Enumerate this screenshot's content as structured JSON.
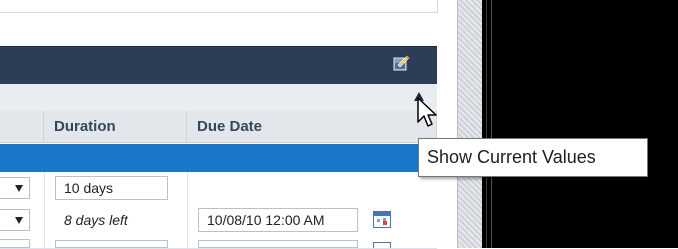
{
  "columns": {
    "duration": "Duration",
    "due_date": "Due Date"
  },
  "rows": [
    {
      "duration": "10 days",
      "due_date": ""
    },
    {
      "duration": "8 days left",
      "due_date": "10/08/10 12:00 AM"
    }
  ],
  "tooltip": "Show Current Values",
  "icons": {
    "header": "notes-edit-icon",
    "calendar": "calendar-icon",
    "sort": "sort-ascending-icon",
    "cursor": "mouse-pointer-icon"
  },
  "colors": {
    "header_bar": "#2c3d55",
    "selected_row": "#1a76c8",
    "tooltip_bg": "#ffffff"
  }
}
